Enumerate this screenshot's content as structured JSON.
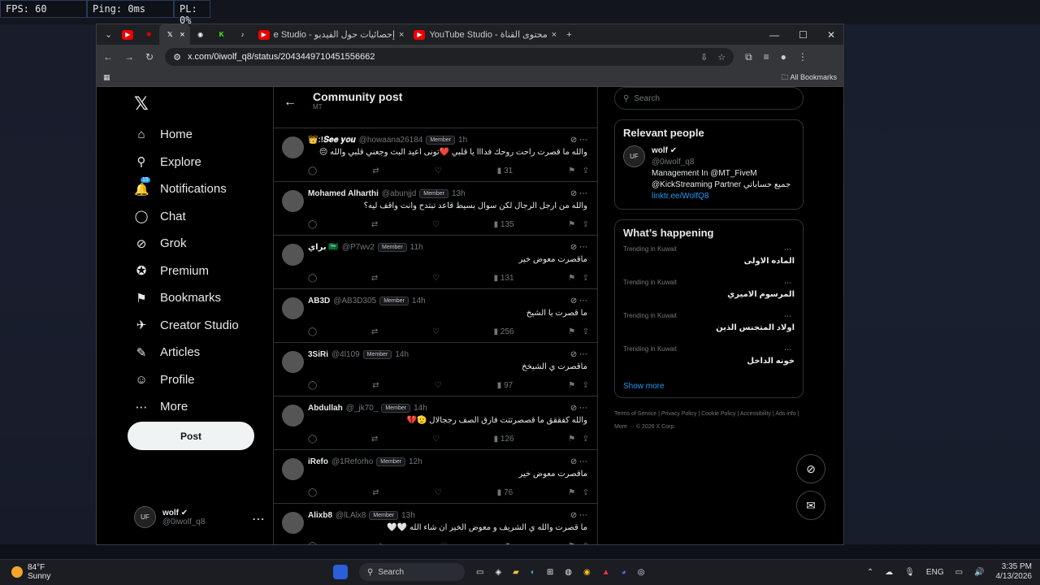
{
  "overlay": {
    "fps": "FPS: 60",
    "ping": "Ping: 0ms",
    "pl": "PL: 0%"
  },
  "browser": {
    "tabs": [
      {
        "label": "",
        "icon": "youtube-icon"
      },
      {
        "label": "",
        "icon": "app-icon"
      },
      {
        "label": "",
        "icon": "x-icon"
      },
      {
        "label": "",
        "icon": "whatsapp-icon"
      },
      {
        "label": "",
        "icon": "kick-icon"
      },
      {
        "label": "",
        "icon": "tiktok-icon"
      },
      {
        "label": "e Studio - إحصائيات حول الفيديو",
        "icon": "youtube-icon"
      },
      {
        "label": "YouTube Studio - محتوى القناة",
        "icon": "youtube-icon"
      }
    ],
    "url": "x.com/0iwolf_q8/status/2043449710451556662",
    "bookmarks_label": "All Bookmarks"
  },
  "sidebar": {
    "logo": "𝕏",
    "items": [
      {
        "label": "Home",
        "icon": "⌂"
      },
      {
        "label": "Explore",
        "icon": "⚲"
      },
      {
        "label": "Notifications",
        "icon": "🔔",
        "badge": "15"
      },
      {
        "label": "Chat",
        "icon": "◯"
      },
      {
        "label": "Grok",
        "icon": "⊘"
      },
      {
        "label": "Premium",
        "icon": "✪"
      },
      {
        "label": "Bookmarks",
        "icon": "⚑"
      },
      {
        "label": "Creator Studio",
        "icon": "✈"
      },
      {
        "label": "Articles",
        "icon": "✎"
      },
      {
        "label": "Profile",
        "icon": "☺"
      },
      {
        "label": "More",
        "icon": "⋯"
      }
    ],
    "post_label": "Post",
    "account": {
      "name": "wolf ✔",
      "handle": "@0iwolf_q8"
    }
  },
  "main": {
    "title": "Community post",
    "subtitle": "MT",
    "posts": [
      {
        "name": "👑:!𝑺𝒆𝒆 𝒚𝒐𝒖",
        "handle": "@howaana26184",
        "time": "1h",
        "text": "والله ما قصرت راحت روحك فدااا يا قلبي ❤️تونى اعيد البث وجعني قلبي والله 😔",
        "views": "31"
      },
      {
        "name": "Mohamed Alharthi",
        "handle": "@abunjjd",
        "time": "13h",
        "text": "والله من ارجل الرجال لكن سوال بسيط قاعد تبتدح وانت واقف ليه؟",
        "views": "135"
      },
      {
        "name": "براي 🇸🇦",
        "handle": "@P7wv2",
        "time": "11h",
        "text": "ماقصرت معوض خير",
        "views": "131"
      },
      {
        "name": "AB3D",
        "handle": "@AB3D305",
        "time": "14h",
        "text": "ما قصرت يا الشيخ",
        "views": "256"
      },
      {
        "name": "3SiRi",
        "handle": "@4l109",
        "time": "14h",
        "text": "ماقصرت ي الشيخخ",
        "views": "97"
      },
      {
        "name": "Abdullah",
        "handle": "@_jk70_",
        "time": "14h",
        "text": "والله كفققق ما قصصرتتت فارق الصف رججالال 🫡💔",
        "views": "126"
      },
      {
        "name": "iRefo",
        "handle": "@1Reforho",
        "time": "12h",
        "text": "ماقصرت معوض خير",
        "views": "76"
      },
      {
        "name": "Alixb8",
        "handle": "@lLAlx8",
        "time": "13h",
        "text": "ما قصرت والله ي الشريف و معوض الخير ان شاء الله 🤍🤍",
        "views": ""
      }
    ],
    "member_label": "Member"
  },
  "right": {
    "search_placeholder": "Search",
    "relevant_title": "Relevant people",
    "person": {
      "name": "wolf ✔",
      "handle": "@0iwolf_q8",
      "bio1": "Management In @MT_FiveM",
      "bio2": "@KickStreaming Partner جميع حساباتي",
      "bio3": "linktr.ee/WolfQ8"
    },
    "happening_title": "What’s happening",
    "trends": [
      {
        "context": "Trending in Kuwait",
        "topic": "الماده الاولى"
      },
      {
        "context": "Trending in Kuwait",
        "topic": "المرسوم الاميري"
      },
      {
        "context": "Trending in Kuwait",
        "topic": "اولاد المتجنس الذين"
      },
      {
        "context": "Trending in Kuwait",
        "topic": "خونه الداخل"
      }
    ],
    "show_more": "Show more",
    "footer": "Terms of Service | Privacy Policy | Cookie Policy | Accessibility | Ads info | More ··· © 2026 X Corp."
  },
  "taskbar": {
    "temp": "84°F",
    "weather": "Sunny",
    "search": "Search",
    "lang": "ENG",
    "time": "3:35 PM",
    "date": "4/13/2026"
  }
}
